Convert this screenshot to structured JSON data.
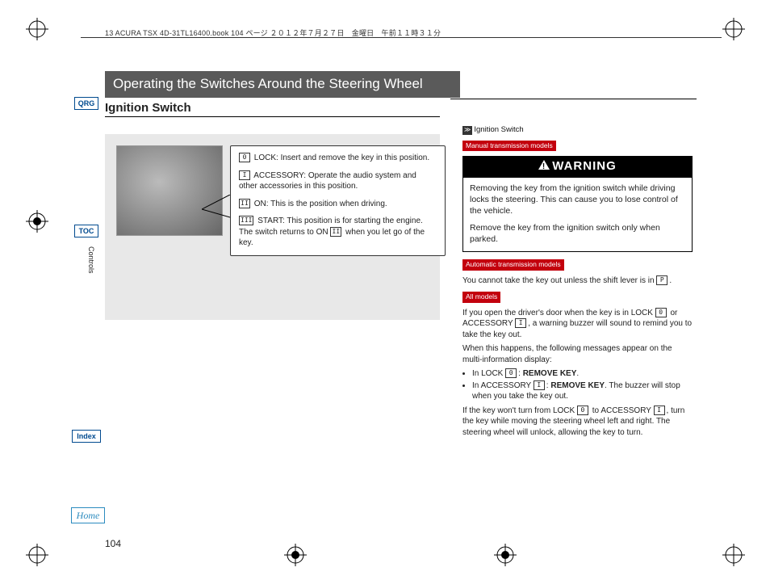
{
  "meta": {
    "header": "13 ACURA TSX 4D-31TL16400.book  104 ページ  ２０１２年７月２７日　金曜日　午前１１時３１分"
  },
  "chapter": "Operating the Switches Around the Steering Wheel",
  "section": "Ignition Switch",
  "nav": {
    "qrg": "QRG",
    "toc": "TOC",
    "index": "Index",
    "home": "Home",
    "side_section": "Controls"
  },
  "positions": {
    "p0": {
      "key": "0",
      "label": "LOCK: Insert and remove the key in this position."
    },
    "p1": {
      "key": "I",
      "label": "ACCESSORY: Operate the audio system and other accessories in this position."
    },
    "p2": {
      "key": "II",
      "label": "ON: This is the position when driving."
    },
    "p3": {
      "key": "III",
      "label_a": "START: This position is for starting the engine. The switch returns to ON ",
      "on_key": "II",
      "label_b": " when you let go of the key."
    }
  },
  "side": {
    "ref_title": "Ignition Switch",
    "tag_manual": "Manual transmission models",
    "warn_title": "WARNING",
    "warn_p1": "Removing the key from the ignition switch while driving locks the steering. This can cause you to lose control of the vehicle.",
    "warn_p2": "Remove the key from the ignition switch only when parked.",
    "tag_auto": "Automatic transmission models",
    "auto_text_a": "You cannot take the key out unless the shift lever is in ",
    "auto_key": "P",
    "auto_text_b": ".",
    "tag_all": "All models",
    "all_p1_a": "If you open the driver's door when the key is in LOCK ",
    "k0": "0",
    "all_p1_b": " or ACCESSORY ",
    "kI": "I",
    "all_p1_c": ", a warning buzzer will sound to remind you to take the key out.",
    "all_p2": "When this happens, the following messages appear on the multi-information display:",
    "bullet1_a": "In LOCK ",
    "bullet1_key": "0",
    "bullet1_b": ": ",
    "bullet1_bold": "REMOVE KEY",
    "bullet1_c": ".",
    "bullet2_a": "In ACCESSORY ",
    "bullet2_key": "I",
    "bullet2_b": ": ",
    "bullet2_bold": "REMOVE KEY",
    "bullet2_c": ". The buzzer will stop when you take the key out.",
    "all_p3_a": "If the key won't turn from LOCK ",
    "all_p3_b": " to ACCESSORY ",
    "all_p3_c": ", turn the key while moving the steering wheel left and right. The steering wheel will unlock, allowing the key to turn."
  },
  "page_number": "104"
}
